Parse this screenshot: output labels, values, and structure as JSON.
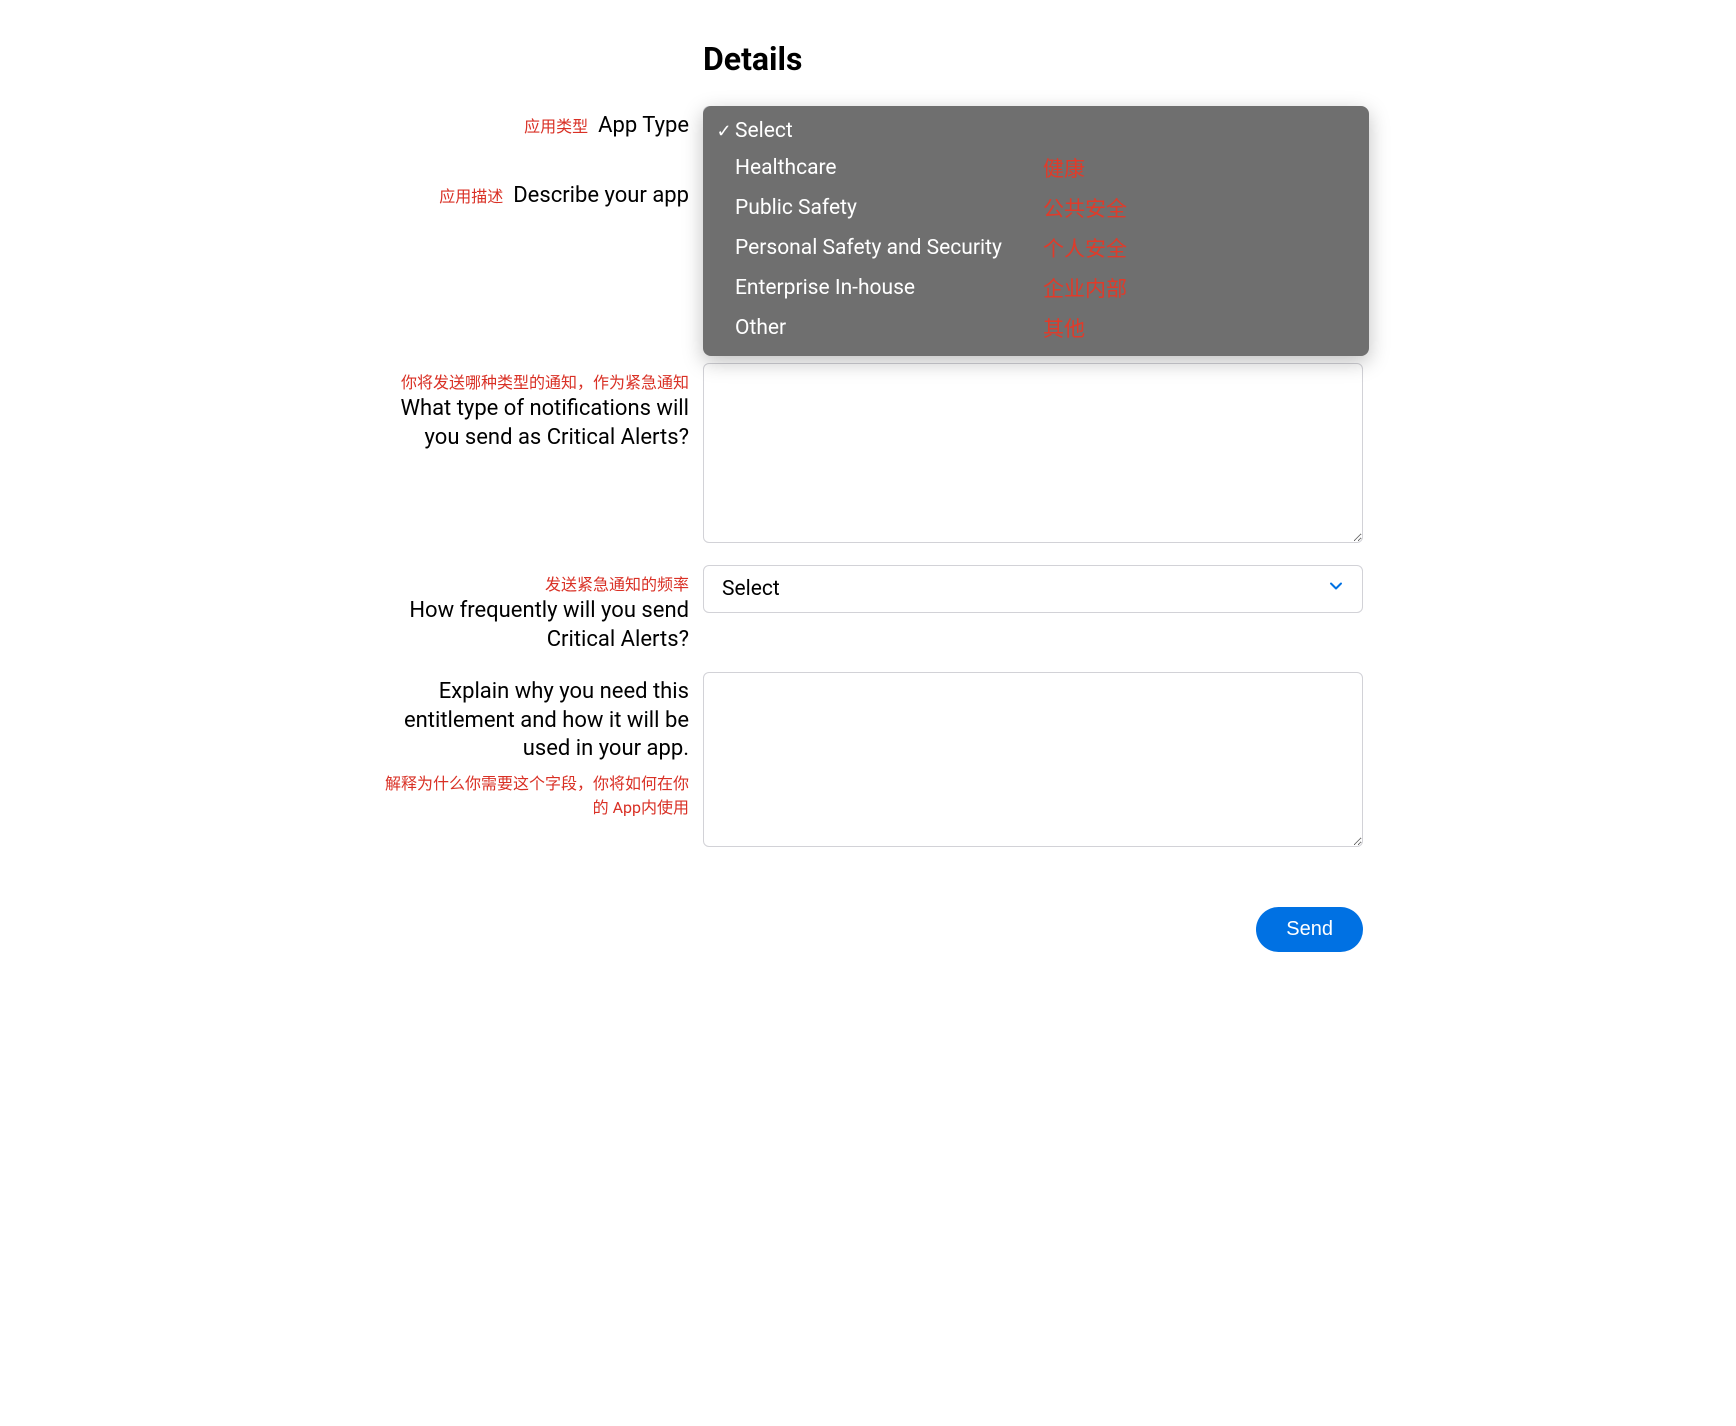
{
  "heading": "Details",
  "fields": {
    "app_type": {
      "annotation": "应用类型",
      "label": "App Type",
      "selected": "Select",
      "options": [
        {
          "checked": true,
          "label": "Select",
          "anno": ""
        },
        {
          "checked": false,
          "label": "Healthcare",
          "anno": "健康"
        },
        {
          "checked": false,
          "label": "Public Safety",
          "anno": "公共安全"
        },
        {
          "checked": false,
          "label": "Personal Safety and Security",
          "anno": "个人安全"
        },
        {
          "checked": false,
          "label": "Enterprise In-house",
          "anno": "企业内部"
        },
        {
          "checked": false,
          "label": "Other",
          "anno": "其他"
        }
      ]
    },
    "describe": {
      "annotation": "应用描述",
      "label": "Describe your app",
      "value": ""
    },
    "notif_type": {
      "annotation": "你将发送哪种类型的通知，作为紧急通知",
      "label": "What type of notifications will you send as Critical Alerts?",
      "value": ""
    },
    "frequency": {
      "annotation": "发送紧急通知的频率",
      "label": "How frequently will you send Critical Alerts?",
      "selected": "Select"
    },
    "explain": {
      "label": "Explain why you need this entitlement and how it will be used in your app.",
      "annotation": "解释为什么你需要这个字段，你将如何在你的 App内使用",
      "value": ""
    }
  },
  "send_button": "Send",
  "check_glyph": "✓"
}
